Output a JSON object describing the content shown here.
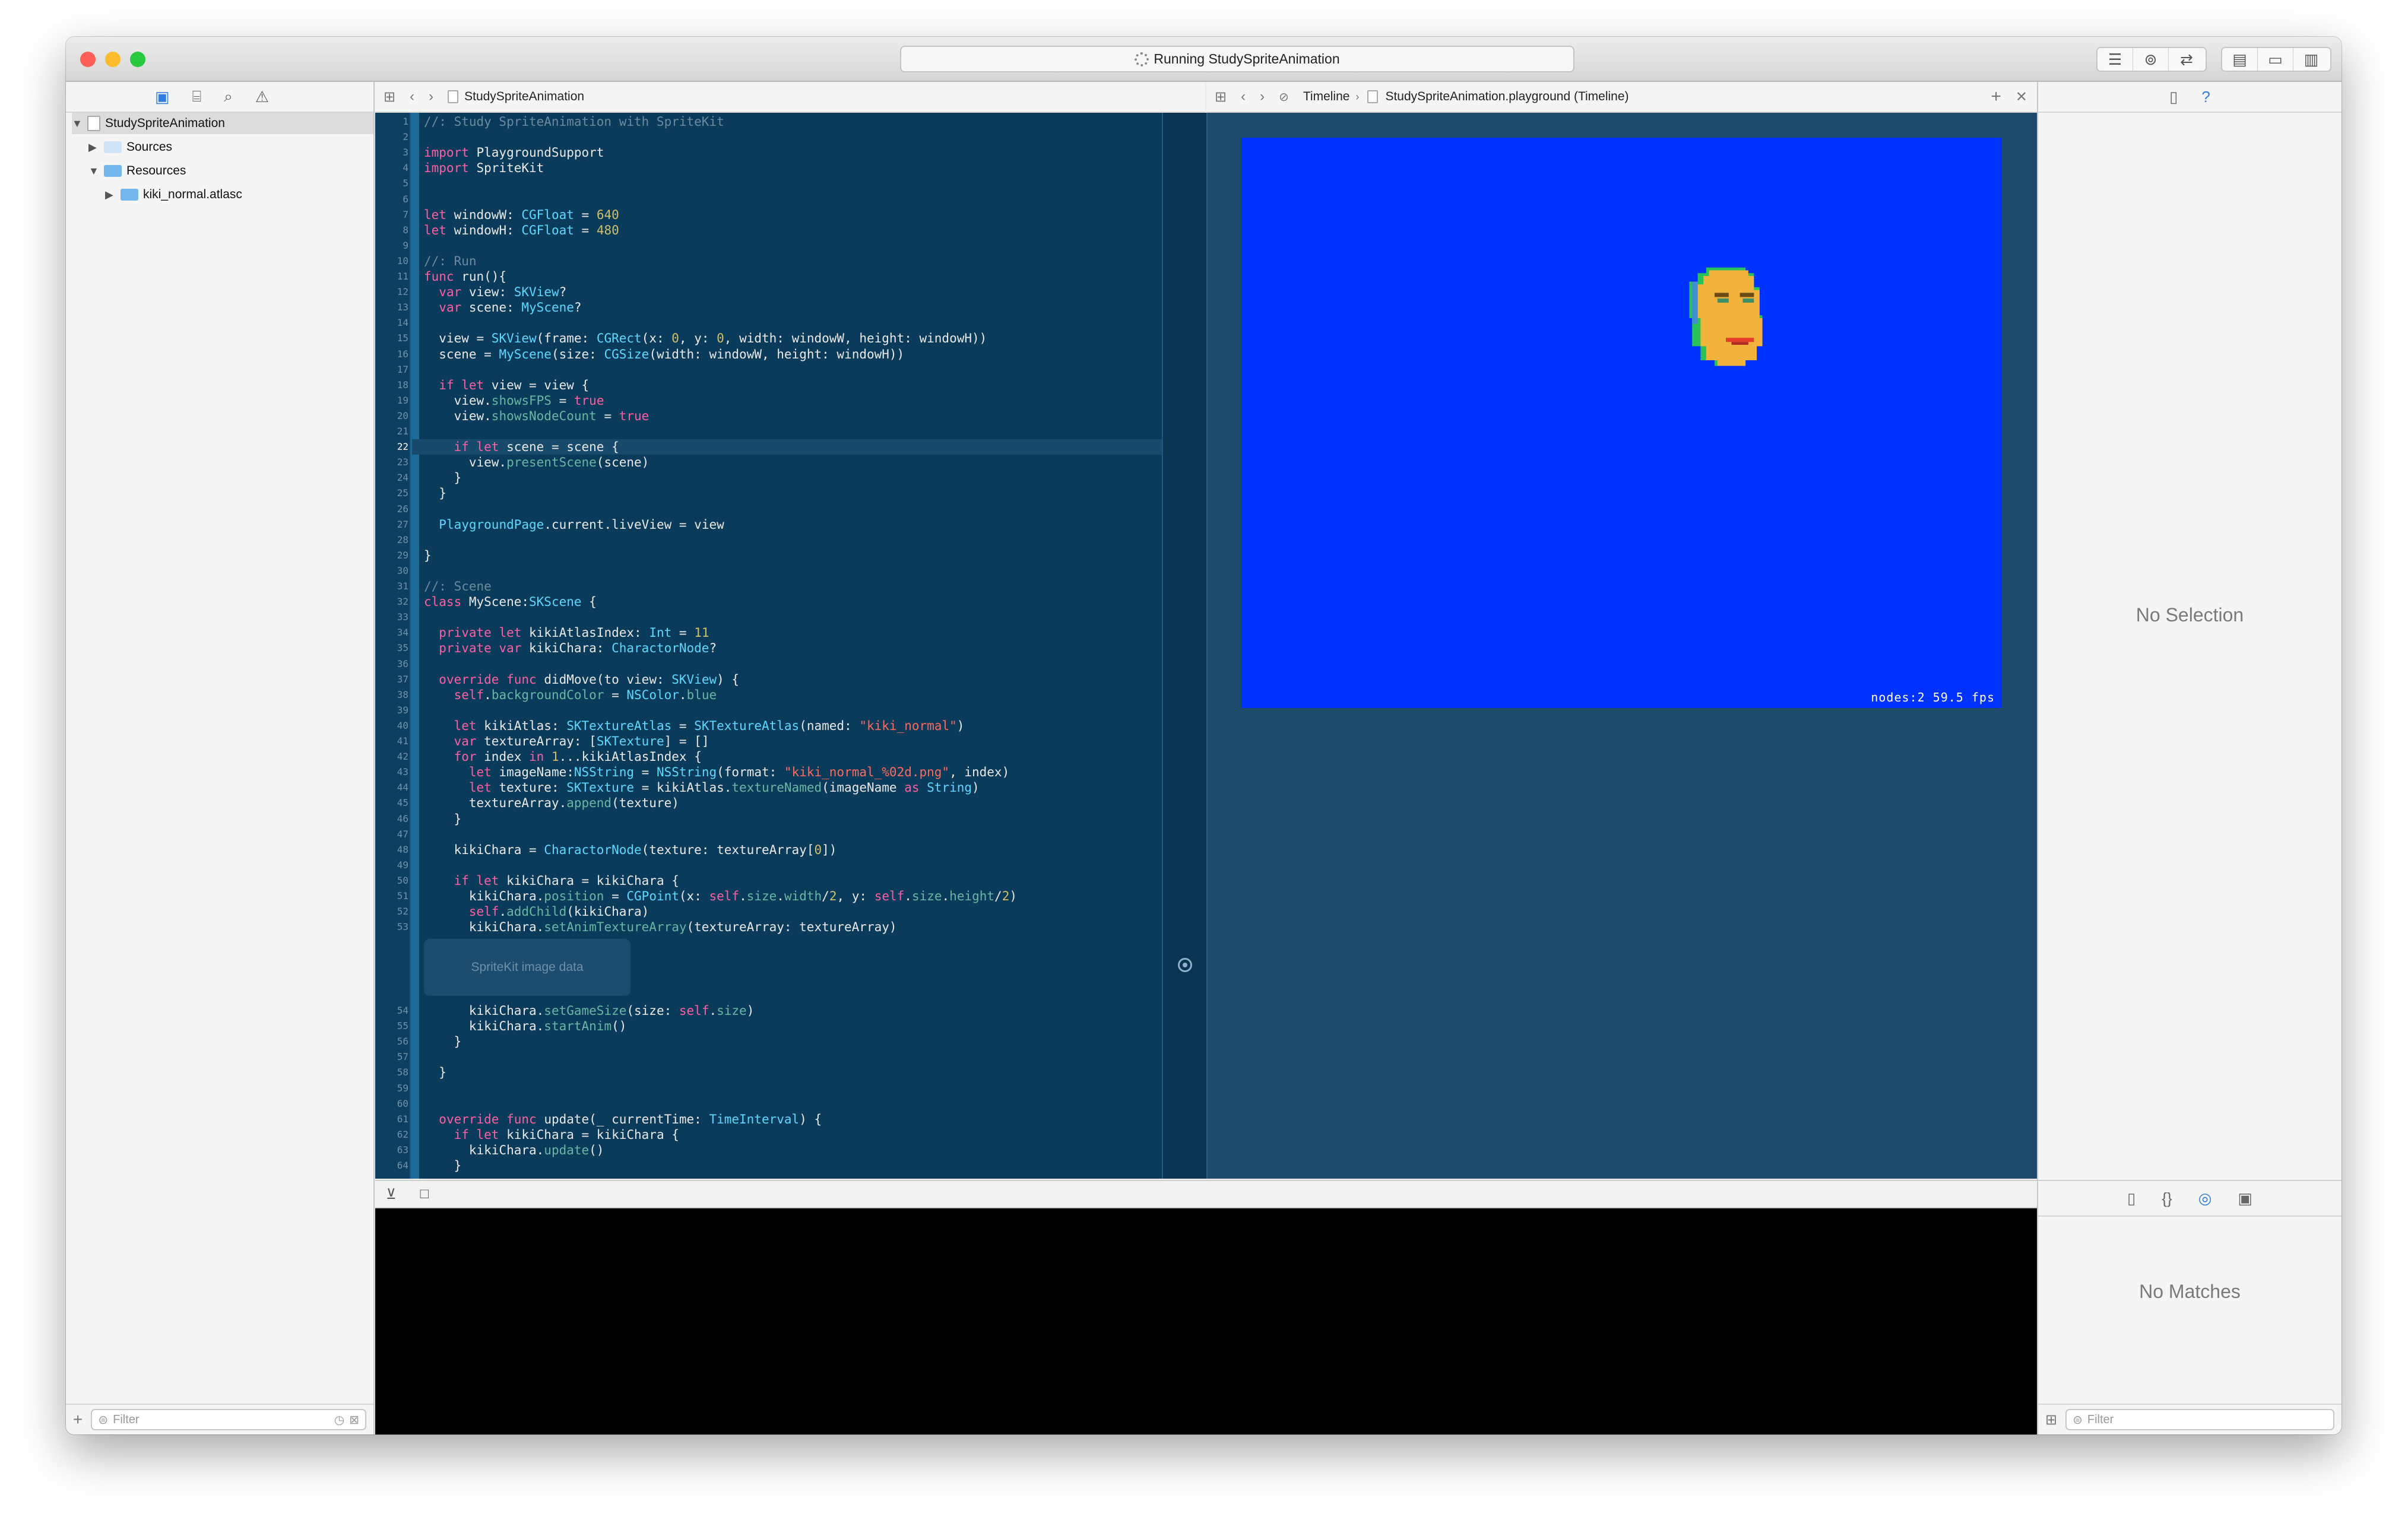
{
  "window": {
    "activity_text": "Running StudySpriteAnimation",
    "traffic": {
      "close": "#fc5f57",
      "minimize": "#fdbc2e",
      "zoom": "#28c840"
    }
  },
  "navigator": {
    "tabs": [
      "folder-icon",
      "hierarchy-icon",
      "search-icon",
      "warning-icon"
    ],
    "tree": [
      {
        "label": "StudySpriteAnimation",
        "depth": 0,
        "expanded": true,
        "icon": "playground-icon"
      },
      {
        "label": "Sources",
        "depth": 1,
        "expanded": false,
        "icon": "folder-icon"
      },
      {
        "label": "Resources",
        "depth": 1,
        "expanded": true,
        "icon": "folder-icon"
      },
      {
        "label": "kiki_normal.atlasc",
        "depth": 2,
        "expanded": false,
        "icon": "folder-icon"
      }
    ],
    "filter_placeholder": "Filter"
  },
  "editor": {
    "jump_file": "StudySpriteAnimation",
    "current_line": 22,
    "image_placeholder": "SpriteKit image data",
    "lines_before": [
      [
        [
          "c",
          "//: Study SpriteAnimation with SpriteKit"
        ]
      ],
      [],
      [
        [
          "k",
          "import"
        ],
        [
          "p",
          " PlaygroundSupport"
        ]
      ],
      [
        [
          "k",
          "import"
        ],
        [
          "p",
          " SpriteKit"
        ]
      ],
      [],
      [],
      [
        [
          "k",
          "let"
        ],
        [
          "p",
          " windowW: "
        ],
        [
          "t",
          "CGFloat"
        ],
        [
          "p",
          " = "
        ],
        [
          "n",
          "640"
        ]
      ],
      [
        [
          "k",
          "let"
        ],
        [
          "p",
          " windowH: "
        ],
        [
          "t",
          "CGFloat"
        ],
        [
          "p",
          " = "
        ],
        [
          "n",
          "480"
        ]
      ],
      [],
      [
        [
          "c",
          "//: Run"
        ]
      ],
      [
        [
          "k",
          "func"
        ],
        [
          "p",
          " run(){"
        ]
      ],
      [
        [
          "p",
          "  "
        ],
        [
          "k",
          "var"
        ],
        [
          "p",
          " view: "
        ],
        [
          "t",
          "SKView"
        ],
        [
          "p",
          "?"
        ]
      ],
      [
        [
          "p",
          "  "
        ],
        [
          "k",
          "var"
        ],
        [
          "p",
          " scene: "
        ],
        [
          "t",
          "MyScene"
        ],
        [
          "p",
          "?"
        ]
      ],
      [],
      [
        [
          "p",
          "  view = "
        ],
        [
          "t",
          "SKView"
        ],
        [
          "p",
          "(frame: "
        ],
        [
          "t",
          "CGRect"
        ],
        [
          "p",
          "(x: "
        ],
        [
          "n",
          "0"
        ],
        [
          "p",
          ", y: "
        ],
        [
          "n",
          "0"
        ],
        [
          "p",
          ", width: windowW, height: windowH))"
        ]
      ],
      [
        [
          "p",
          "  scene = "
        ],
        [
          "t",
          "MyScene"
        ],
        [
          "p",
          "(size: "
        ],
        [
          "t",
          "CGSize"
        ],
        [
          "p",
          "(width: windowW, height: windowH))"
        ]
      ],
      [],
      [
        [
          "p",
          "  "
        ],
        [
          "k",
          "if let"
        ],
        [
          "p",
          " view = view {"
        ]
      ],
      [
        [
          "p",
          "    view."
        ],
        [
          "f",
          "showsFPS"
        ],
        [
          "p",
          " = "
        ],
        [
          "k",
          "true"
        ]
      ],
      [
        [
          "p",
          "    view."
        ],
        [
          "f",
          "showsNodeCount"
        ],
        [
          "p",
          " = "
        ],
        [
          "k",
          "true"
        ]
      ],
      [],
      [
        [
          "p",
          "    "
        ],
        [
          "k",
          "if let"
        ],
        [
          "p",
          " scene = scene {"
        ]
      ],
      [
        [
          "p",
          "      view."
        ],
        [
          "f",
          "presentScene"
        ],
        [
          "p",
          "(scene)"
        ]
      ],
      [
        [
          "p",
          "    }"
        ]
      ],
      [
        [
          "p",
          "  }"
        ]
      ],
      [],
      [
        [
          "p",
          "  "
        ],
        [
          "t",
          "PlaygroundPage"
        ],
        [
          "p",
          ".current.liveView = view"
        ]
      ],
      [],
      [
        [
          "p",
          "}"
        ]
      ],
      [],
      [
        [
          "c",
          "//: Scene"
        ]
      ],
      [
        [
          "k",
          "class"
        ],
        [
          "p",
          " MyScene:"
        ],
        [
          "t",
          "SKScene"
        ],
        [
          "p",
          " {"
        ]
      ],
      [],
      [
        [
          "p",
          "  "
        ],
        [
          "k",
          "private let"
        ],
        [
          "p",
          " kikiAtlasIndex: "
        ],
        [
          "t",
          "Int"
        ],
        [
          "p",
          " = "
        ],
        [
          "n",
          "11"
        ]
      ],
      [
        [
          "p",
          "  "
        ],
        [
          "k",
          "private var"
        ],
        [
          "p",
          " kikiChara: "
        ],
        [
          "t",
          "CharactorNode"
        ],
        [
          "p",
          "?"
        ]
      ],
      [],
      [
        [
          "p",
          "  "
        ],
        [
          "k",
          "override func"
        ],
        [
          "p",
          " didMove(to view: "
        ],
        [
          "t",
          "SKView"
        ],
        [
          "p",
          ") {"
        ]
      ],
      [
        [
          "p",
          "    "
        ],
        [
          "k",
          "self"
        ],
        [
          "p",
          "."
        ],
        [
          "f",
          "backgroundColor"
        ],
        [
          "p",
          " = "
        ],
        [
          "t",
          "NSColor"
        ],
        [
          "p",
          "."
        ],
        [
          "f",
          "blue"
        ]
      ],
      [],
      [
        [
          "p",
          "    "
        ],
        [
          "k",
          "let"
        ],
        [
          "p",
          " kikiAtlas: "
        ],
        [
          "t",
          "SKTextureAtlas"
        ],
        [
          "p",
          " = "
        ],
        [
          "t",
          "SKTextureAtlas"
        ],
        [
          "p",
          "(named: "
        ],
        [
          "s",
          "\"kiki_normal\""
        ],
        [
          "p",
          ")"
        ]
      ],
      [
        [
          "p",
          "    "
        ],
        [
          "k",
          "var"
        ],
        [
          "p",
          " textureArray: ["
        ],
        [
          "t",
          "SKTexture"
        ],
        [
          "p",
          "] = []"
        ]
      ],
      [
        [
          "p",
          "    "
        ],
        [
          "k",
          "for"
        ],
        [
          "p",
          " index "
        ],
        [
          "k",
          "in"
        ],
        [
          "p",
          " "
        ],
        [
          "n",
          "1"
        ],
        [
          "p",
          "...kikiAtlasIndex {"
        ]
      ],
      [
        [
          "p",
          "      "
        ],
        [
          "k",
          "let"
        ],
        [
          "p",
          " imageName:"
        ],
        [
          "t",
          "NSString"
        ],
        [
          "p",
          " = "
        ],
        [
          "t",
          "NSString"
        ],
        [
          "p",
          "(format: "
        ],
        [
          "s",
          "\"kiki_normal_%02d.png\""
        ],
        [
          "p",
          ", index)"
        ]
      ],
      [
        [
          "p",
          "      "
        ],
        [
          "k",
          "let"
        ],
        [
          "p",
          " texture: "
        ],
        [
          "t",
          "SKTexture"
        ],
        [
          "p",
          " = kikiAtlas."
        ],
        [
          "f",
          "textureNamed"
        ],
        [
          "p",
          "(imageName "
        ],
        [
          "k",
          "as"
        ],
        [
          "p",
          " "
        ],
        [
          "t",
          "String"
        ],
        [
          "p",
          ")"
        ]
      ],
      [
        [
          "p",
          "      textureArray."
        ],
        [
          "f",
          "append"
        ],
        [
          "p",
          "(texture)"
        ]
      ],
      [
        [
          "p",
          "    }"
        ]
      ],
      [],
      [
        [
          "p",
          "    kikiChara = "
        ],
        [
          "t",
          "CharactorNode"
        ],
        [
          "p",
          "(texture: textureArray["
        ],
        [
          "n",
          "0"
        ],
        [
          "p",
          "])"
        ]
      ],
      [],
      [
        [
          "p",
          "    "
        ],
        [
          "k",
          "if let"
        ],
        [
          "p",
          " kikiChara = kikiChara {"
        ]
      ],
      [
        [
          "p",
          "      kikiChara."
        ],
        [
          "f",
          "position"
        ],
        [
          "p",
          " = "
        ],
        [
          "t",
          "CGPoint"
        ],
        [
          "p",
          "(x: "
        ],
        [
          "k",
          "self"
        ],
        [
          "p",
          "."
        ],
        [
          "f",
          "size"
        ],
        [
          "p",
          "."
        ],
        [
          "f",
          "width"
        ],
        [
          "p",
          "/"
        ],
        [
          "n",
          "2"
        ],
        [
          "p",
          ", y: "
        ],
        [
          "k",
          "self"
        ],
        [
          "p",
          "."
        ],
        [
          "f",
          "size"
        ],
        [
          "p",
          "."
        ],
        [
          "f",
          "height"
        ],
        [
          "p",
          "/"
        ],
        [
          "n",
          "2"
        ],
        [
          "p",
          ")"
        ]
      ],
      [
        [
          "p",
          "      "
        ],
        [
          "k",
          "self"
        ],
        [
          "p",
          "."
        ],
        [
          "f",
          "addChild"
        ],
        [
          "p",
          "(kikiChara)"
        ]
      ],
      [
        [
          "p",
          "      kikiChara."
        ],
        [
          "f",
          "setAnimTextureArray"
        ],
        [
          "p",
          "(textureArray: textureArray)"
        ]
      ]
    ],
    "lines_after": [
      [
        [
          "p",
          "      kikiChara."
        ],
        [
          "f",
          "setGameSize"
        ],
        [
          "p",
          "(size: "
        ],
        [
          "k",
          "self"
        ],
        [
          "p",
          "."
        ],
        [
          "f",
          "size"
        ],
        [
          "p",
          ")"
        ]
      ],
      [
        [
          "p",
          "      kikiChara."
        ],
        [
          "f",
          "startAnim"
        ],
        [
          "p",
          "()"
        ]
      ],
      [
        [
          "p",
          "    }"
        ]
      ],
      [],
      [
        [
          "p",
          "  }"
        ]
      ],
      [],
      [],
      [
        [
          "p",
          "  "
        ],
        [
          "k",
          "override func"
        ],
        [
          "p",
          " update(_ currentTime: "
        ],
        [
          "t",
          "TimeInterval"
        ],
        [
          "p",
          ") {"
        ]
      ],
      [
        [
          "p",
          "    "
        ],
        [
          "k",
          "if let"
        ],
        [
          "p",
          " kikiChara = kikiChara {"
        ]
      ],
      [
        [
          "p",
          "      kikiChara."
        ],
        [
          "f",
          "update"
        ],
        [
          "p",
          "()"
        ]
      ],
      [
        [
          "p",
          "    }"
        ]
      ]
    ]
  },
  "timeline": {
    "jump_label": "Timeline",
    "jump_file": "StudySpriteAnimation.playground (Timeline)",
    "scene_color": "#0032ff",
    "hud": "nodes:2   59.5 fps"
  },
  "inspector": {
    "no_selection": "No Selection",
    "no_matches": "No Matches",
    "filter_placeholder": "Filter"
  }
}
